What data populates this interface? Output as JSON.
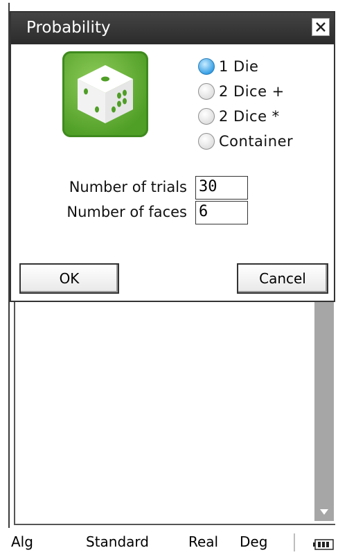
{
  "dialog": {
    "title": "Probability",
    "close_icon": "close-x-icon",
    "die_icon": "die-icon",
    "radio_options": [
      {
        "label": "1 Die",
        "selected": true
      },
      {
        "label": "2 Dice +",
        "selected": false
      },
      {
        "label": "2 Dice *",
        "selected": false
      },
      {
        "label": "Container",
        "selected": false
      }
    ],
    "fields": {
      "trials_label": "Number of trials",
      "trials_value": "30",
      "faces_label": "Number of faces",
      "faces_value": "6"
    },
    "buttons": {
      "ok": "OK",
      "cancel": "Cancel"
    }
  },
  "scroll_down_icon": "triangle-down-icon",
  "statusbar": {
    "mode": "Alg",
    "format": "Standard",
    "number": "Real",
    "angle": "Deg",
    "battery_icon": "battery-icon"
  },
  "colors": {
    "title_bar": "#333333",
    "die_green": "#5aa82b",
    "radio_selected": "#2f9be3",
    "scrollbar": "#a6a6a6"
  }
}
